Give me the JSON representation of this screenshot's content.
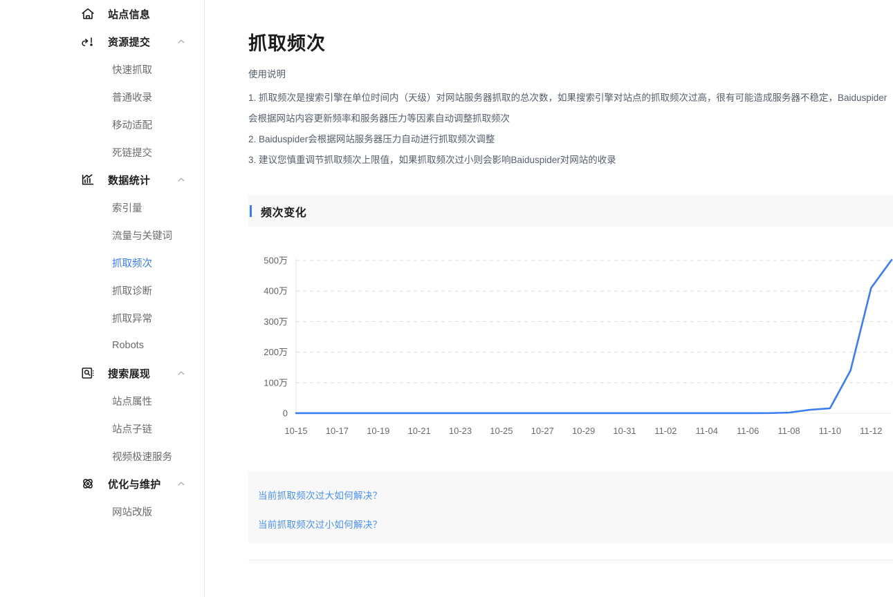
{
  "sidebar": {
    "groups": [
      {
        "id": "site-info",
        "icon": "home-icon",
        "label": "站点信息",
        "collapsible": false,
        "chevron": "",
        "items": []
      },
      {
        "id": "resource-submit",
        "icon": "upload-arrow-icon",
        "label": "资源提交",
        "collapsible": true,
        "chevron": "chevron-up-icon",
        "items": [
          {
            "label": "快速抓取",
            "active": false
          },
          {
            "label": "普通收录",
            "active": false
          },
          {
            "label": "移动适配",
            "active": false
          },
          {
            "label": "死链提交",
            "active": false
          }
        ]
      },
      {
        "id": "data-stats",
        "icon": "bar-chart-icon",
        "label": "数据统计",
        "collapsible": true,
        "chevron": "chevron-up-icon",
        "items": [
          {
            "label": "索引量",
            "active": false
          },
          {
            "label": "流量与关键词",
            "active": false
          },
          {
            "label": "抓取频次",
            "active": true
          },
          {
            "label": "抓取诊断",
            "active": false
          },
          {
            "label": "抓取异常",
            "active": false
          },
          {
            "label": "Robots",
            "active": false
          }
        ]
      },
      {
        "id": "search-display",
        "icon": "search-box-icon",
        "label": "搜索展现",
        "collapsible": true,
        "chevron": "chevron-up-icon",
        "items": [
          {
            "label": "站点属性",
            "active": false
          },
          {
            "label": "站点子链",
            "active": false
          },
          {
            "label": "视频极速服务",
            "active": false
          }
        ]
      },
      {
        "id": "optimize-maintain",
        "icon": "atom-icon",
        "label": "优化与维护",
        "collapsible": true,
        "chevron": "chevron-up-icon",
        "items": [
          {
            "label": "网站改版",
            "active": false
          }
        ]
      }
    ]
  },
  "main": {
    "page_title": "抓取频次",
    "intro": {
      "lead": "使用说明",
      "items": [
        "1. 抓取频次是搜索引擎在单位时间内（天级）对网站服务器抓取的总次数，如果搜索引擎对站点的抓取频次过高，很有可能造成服务器不稳定，Baiduspider",
        "会根据网站内容更新频率和服务器压力等因素自动调整抓取频次",
        "2. Baiduspider会根据网站服务器压力自动进行抓取频次调整",
        "3. 建议您慎重调节抓取频次上限值，如果抓取频次过小则会影响Baiduspider对网站的收录"
      ]
    },
    "section": {
      "title": "频次变化",
      "accent_color": "#3a7cf5"
    },
    "links": [
      {
        "label": "当前抓取频次过大如何解决？"
      },
      {
        "label": "当前抓取频次过小如何解决？"
      }
    ]
  },
  "chart_data": {
    "type": "line",
    "title": "频次变化",
    "xlabel": "",
    "ylabel": "",
    "line_color": "#3a7cf5",
    "grid": true,
    "grid_style": "dashed-horizontal",
    "legend": "none",
    "ylim": [
      0,
      5000000
    ],
    "ytick_values": [
      0,
      1000000,
      2000000,
      3000000,
      4000000,
      5000000
    ],
    "ytick_labels": [
      "0",
      "100万",
      "200万",
      "300万",
      "400万",
      "500万"
    ],
    "x": [
      "10-15",
      "10-16",
      "10-17",
      "10-18",
      "10-19",
      "10-20",
      "10-21",
      "10-22",
      "10-23",
      "10-24",
      "10-25",
      "10-26",
      "10-27",
      "10-28",
      "10-29",
      "10-30",
      "10-31",
      "11-01",
      "11-02",
      "11-03",
      "11-04",
      "11-05",
      "11-06",
      "11-07",
      "11-08",
      "11-09",
      "11-10",
      "11-11",
      "11-12",
      "11-13"
    ],
    "xtick_labels": [
      "10-15",
      "10-17",
      "10-19",
      "10-21",
      "10-23",
      "10-25",
      "10-27",
      "10-29",
      "10-31",
      "11-02",
      "11-04",
      "11-06",
      "11-08",
      "11-10",
      "11-12"
    ],
    "values": [
      2000,
      2000,
      2000,
      2000,
      2000,
      2000,
      2000,
      2000,
      2000,
      2000,
      2000,
      2000,
      2000,
      2000,
      2000,
      2000,
      2000,
      2000,
      2000,
      2000,
      2000,
      2000,
      2000,
      3000,
      20000,
      110000,
      160000,
      1400000,
      4100000,
      5020000
    ]
  }
}
